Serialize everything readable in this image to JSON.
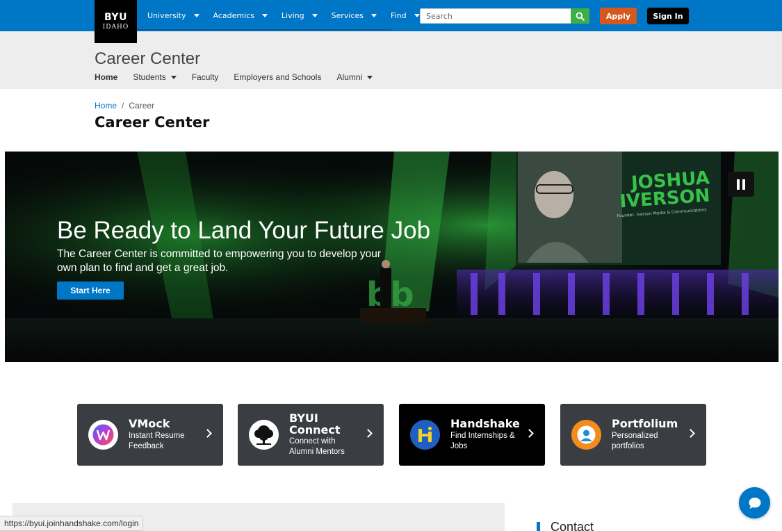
{
  "brand": {
    "logo_line1": "BYU",
    "logo_line2": "IDAHO"
  },
  "top_nav": {
    "items": [
      {
        "label": "University"
      },
      {
        "label": "Academics"
      },
      {
        "label": "Living"
      },
      {
        "label": "Services"
      },
      {
        "label": "Find"
      }
    ],
    "search": {
      "placeholder": "Search",
      "value": ""
    },
    "apply_label": "Apply",
    "signin_label": "Sign In"
  },
  "site": {
    "title": "Career Center",
    "nav": [
      {
        "label": "Home",
        "active": true,
        "dropdown": false
      },
      {
        "label": "Students",
        "active": false,
        "dropdown": true
      },
      {
        "label": "Faculty",
        "active": false,
        "dropdown": false
      },
      {
        "label": "Employers and Schools",
        "active": false,
        "dropdown": false
      },
      {
        "label": "Alumni",
        "active": false,
        "dropdown": true
      }
    ]
  },
  "breadcrumb": {
    "home": "Home",
    "separator": "/",
    "current": "Career"
  },
  "page_title": "Career Center",
  "hero": {
    "headline": "Be Ready to Land Your Future Job",
    "subtext": "The Career Center is committed to empowering you to develop your own plan to find and get a great job.",
    "button_label": "Start Here",
    "screen_name_line1": "JOSHUA",
    "screen_name_line2": "IVERSON",
    "screen_caption": "Founder, Iverson Media & Communications",
    "stage_letters": "bb"
  },
  "cards": [
    {
      "title": "VMock",
      "desc": "Instant Resume Feedback",
      "icon": "vmock-logo-icon",
      "style": "gray"
    },
    {
      "title_line1": "BYUI",
      "title_line2": "Connect",
      "desc": "Connect with Alumni Mentors",
      "icon": "tree-logo-icon",
      "style": "gray"
    },
    {
      "title": "Handshake",
      "desc": "Find Internships & Jobs",
      "icon": "handshake-logo-icon",
      "style": "dark"
    },
    {
      "title": "Portfolium",
      "desc": "Personalized portfolios",
      "icon": "portfolium-logo-icon",
      "style": "gray"
    }
  ],
  "contact_heading": "Contact",
  "status_url": "https://byui.joinhandshake.com/login",
  "colors": {
    "primary_blue": "#0076c6",
    "apply_orange": "#d5581f",
    "search_green": "#3fae49",
    "card_gray": "#3a3d42"
  }
}
